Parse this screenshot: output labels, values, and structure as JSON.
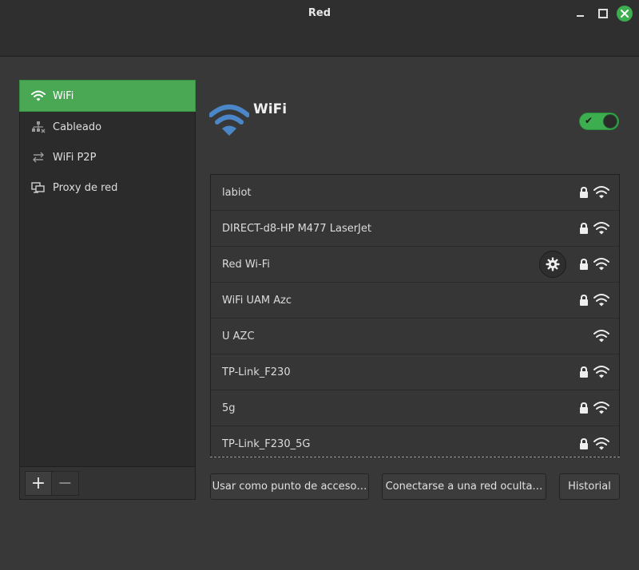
{
  "window": {
    "title": "Red"
  },
  "sidebar": {
    "items": [
      {
        "label": "WiFi",
        "icon": "wifi-icon",
        "active": true
      },
      {
        "label": "Cableado",
        "icon": "wired-network-icon",
        "active": false
      },
      {
        "label": "WiFi P2P",
        "icon": "p2p-arrows-icon",
        "active": false
      },
      {
        "label": "Proxy de red",
        "icon": "network-proxy-icon",
        "active": false
      }
    ],
    "add_label": "+",
    "remove_label": "−"
  },
  "main": {
    "title": "WiFi",
    "wifi_enabled": true,
    "networks": [
      {
        "name": "labiot",
        "secured": true,
        "configured": false
      },
      {
        "name": "DIRECT-d8-HP M477 LaserJet",
        "secured": true,
        "configured": false
      },
      {
        "name": "Red Wi-Fi",
        "secured": true,
        "configured": true
      },
      {
        "name": "WiFi UAM Azc",
        "secured": true,
        "configured": false
      },
      {
        "name": "U AZC",
        "secured": false,
        "configured": false
      },
      {
        "name": "TP-Link_F230",
        "secured": true,
        "configured": false
      },
      {
        "name": "5g",
        "secured": true,
        "configured": false
      },
      {
        "name": "TP-Link_F230_5G",
        "secured": true,
        "configured": false
      }
    ],
    "buttons": {
      "hotspot": "Usar como punto de acceso…",
      "hidden": "Conectarse a una red oculta…",
      "history": "Historial"
    }
  },
  "colors": {
    "accent": "#3dae4f",
    "active_item": "#4aa855",
    "wifi_blue": "#4a86c8"
  }
}
